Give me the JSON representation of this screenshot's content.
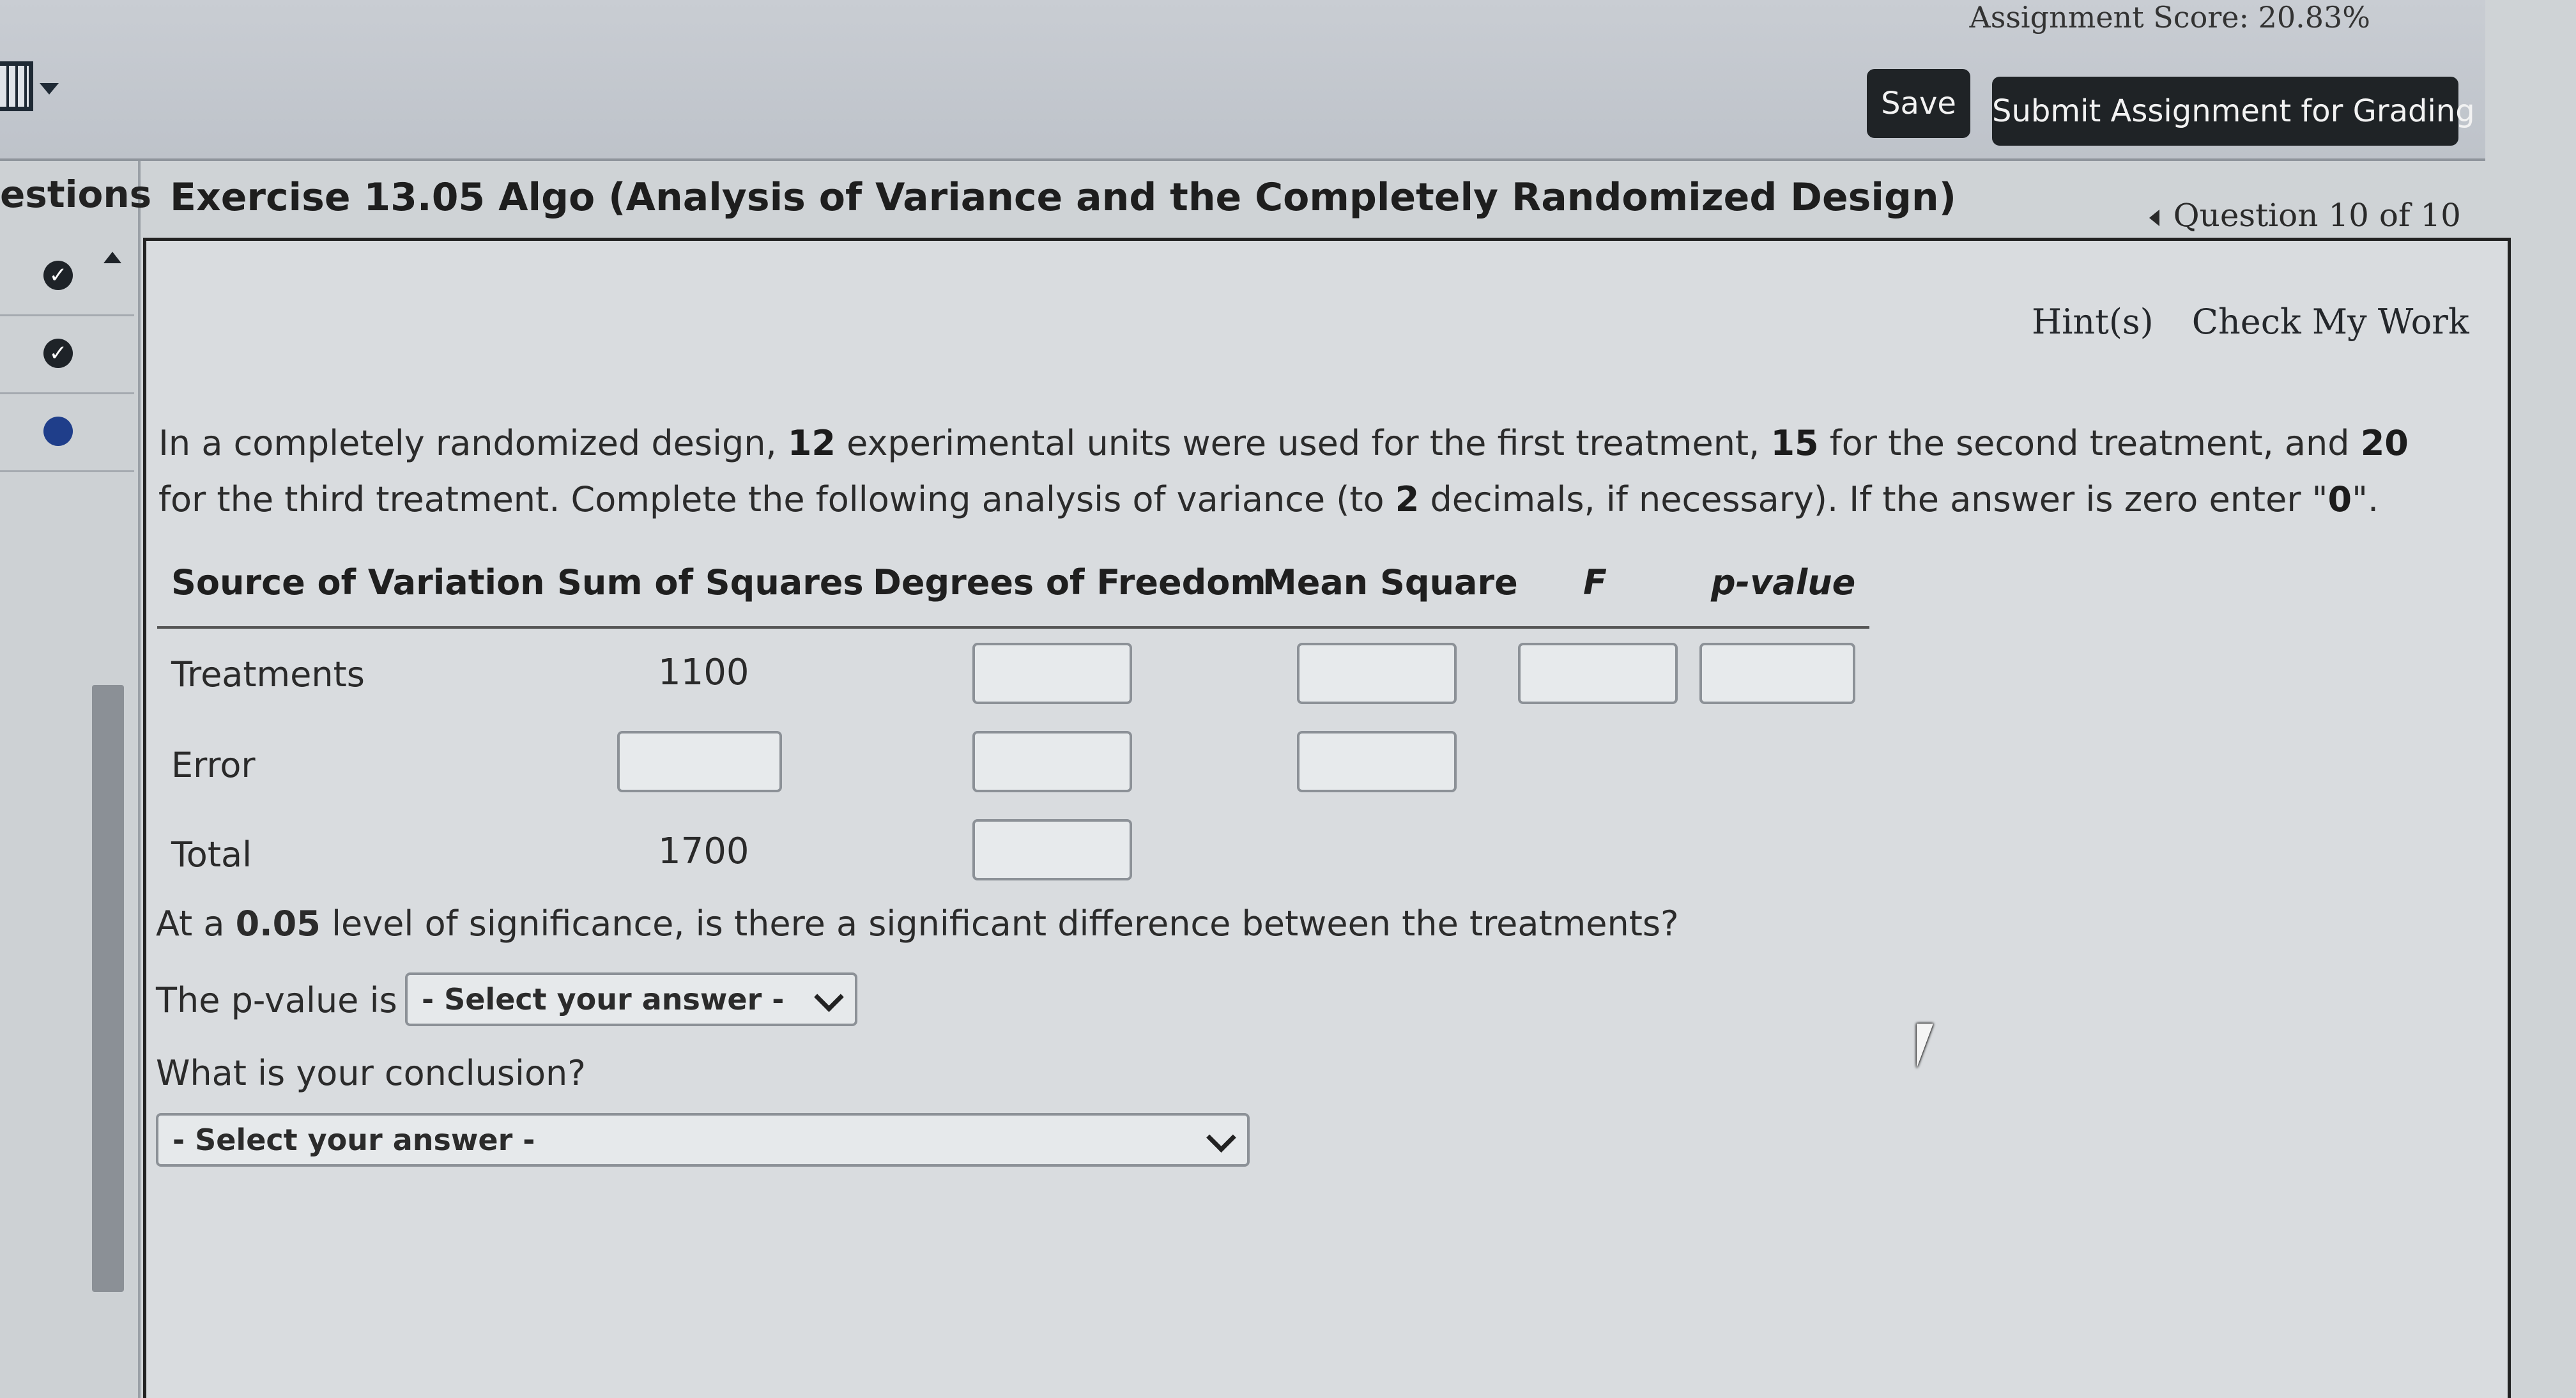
{
  "header": {
    "assignment_score": "Assignment Score: 20.83%",
    "save_label": "Save",
    "submit_label": "Submit Assignment for Grading",
    "calculator_icon": "calculator-icon"
  },
  "sidebar": {
    "title": "estions",
    "items": [
      {
        "status": "answered",
        "glyph": "✓"
      },
      {
        "status": "answered",
        "glyph": "✓"
      },
      {
        "status": "current",
        "glyph": ""
      }
    ]
  },
  "exercise": {
    "title": "Exercise 13.05 Algo (Analysis of Variance and the Completely Randomized Design)",
    "question_nav": "Question 10 of 10",
    "hints_label": "Hint(s)",
    "check_label": "Check My Work",
    "prompt_parts": [
      "In a completely randomized design, ",
      "12",
      " experimental units were used for the first treatment, ",
      "15",
      " for the second treatment, and ",
      "20",
      " for the third treatment. Complete the following analysis of variance (to ",
      "2",
      " decimals, if necessary). If the answer is zero enter \"",
      "0",
      "\"."
    ]
  },
  "anova": {
    "headers": [
      "Source of Variation",
      "Sum of Squares",
      "Degrees of Freedom",
      "Mean Square",
      "F",
      "p-value"
    ],
    "rows": [
      {
        "source": "Treatments",
        "sum_of_squares": "1100"
      },
      {
        "source": "Error",
        "sum_of_squares": ""
      },
      {
        "source": "Total",
        "sum_of_squares": "1700"
      }
    ]
  },
  "questions": {
    "significance_parts": [
      "At a ",
      "0.05",
      " level of significance, is there a significant difference between the treatments?"
    ],
    "pvalue_label": "The p-value is",
    "pvalue_select": "- Select your answer -",
    "conclusion_label": "What is your conclusion?",
    "conclusion_select": "- Select your answer -"
  },
  "colors": {
    "button_bg": "#1f2326",
    "current_question": "#1f3e8a"
  }
}
